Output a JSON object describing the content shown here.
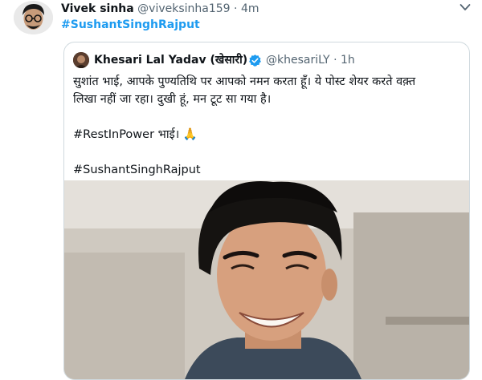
{
  "tweet": {
    "author_name": "Vivek sinha",
    "handle": "@viveksinha159",
    "separator": "·",
    "time": "4m",
    "hashtag": "#SushantSinghRajput"
  },
  "quoted_tweet": {
    "author_name": "Khesari Lal Yadav (खेसारी)",
    "handle": "@khesariLY",
    "separator": "·",
    "time": "1h",
    "line1": "सुशांत भाई, आपके पुण्यतिथि पर आपको नमन करता हूँ। ये पोस्ट शेयर करते वक़्त",
    "line2": "लिखा नहीं जा रहा। दुखी हूं, मन टूट सा गया है।",
    "line3": "#RestInPower भाई। 🙏",
    "line4": "#SushantSinghRajput"
  },
  "icons": {
    "more": "chevron-down-icon",
    "verified": "verified-badge-icon"
  },
  "colors": {
    "link": "#1d9bf0",
    "text": "#0f1419",
    "muted": "#536471",
    "border": "#cfd9de"
  }
}
